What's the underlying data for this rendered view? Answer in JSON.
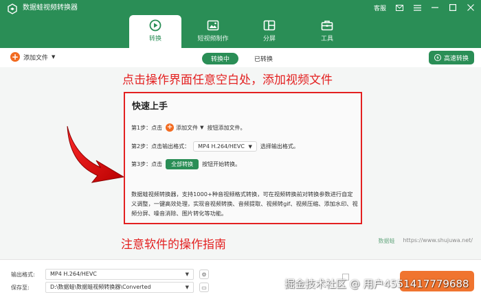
{
  "app": {
    "title": "数据蛙视频转换器",
    "feedback_label": "客服",
    "icons": [
      "app-logo-icon",
      "mail-icon",
      "menu-icon",
      "minimize-icon",
      "maximize-icon",
      "close-icon"
    ]
  },
  "nav": {
    "tabs": [
      {
        "label": "转换",
        "icon": "convert-icon",
        "active": true
      },
      {
        "label": "短视频制作",
        "icon": "video-maker-icon",
        "active": false
      },
      {
        "label": "分屏",
        "icon": "split-screen-icon",
        "active": false
      },
      {
        "label": "工具",
        "icon": "toolbox-icon",
        "active": false
      }
    ]
  },
  "toolbar": {
    "add_file_label": "添加文件",
    "segments": [
      {
        "label": "转换中",
        "active": true
      },
      {
        "label": "已转换",
        "active": false
      }
    ],
    "fast_convert_label": "高速转换"
  },
  "annotations": {
    "top": "点击操作界面任意空白处，添加视频文件",
    "bottom": "注意软件的操作指南"
  },
  "guide": {
    "title": "快速上手",
    "step1_prefix": "第1步：点击",
    "step1_button": "添加文件",
    "step1_suffix": "按钮添加文件。",
    "step2_prefix": "第2步：点击输出格式：",
    "step2_format": "MP4 H.264/HEVC",
    "step2_suffix": "选择输出格式。",
    "step3_prefix": "第3步：点击",
    "step3_button": "全部转换",
    "step3_suffix": "按钮开始转换。",
    "description": "数据蛙视频转换器，支持1000+种音视频格式转换，可在视频转换前对转换参数进行自定义调整，一键高效处理，实现音视频转换、音频提取、视频转gif、视频压缩、添加水印、视频分屏、噪音消除、图片转化等功能。"
  },
  "watermark": {
    "brand": "数据蛙",
    "url": "https://www.shujuwa.net/"
  },
  "footer": {
    "output_format_label": "输出格式:",
    "output_format_value": "MP4 H.264/HEVC",
    "save_to_label": "保存至:",
    "save_to_value": "D:\\数据蛙\\数据蛙视频转换器\\Converted"
  },
  "overlay_watermark": "掘金技术社区 @ 用户4551417779688",
  "colors": {
    "brand_green": "#2a8e56",
    "accent_orange": "#f26b21",
    "annotation_red": "#e32020"
  }
}
